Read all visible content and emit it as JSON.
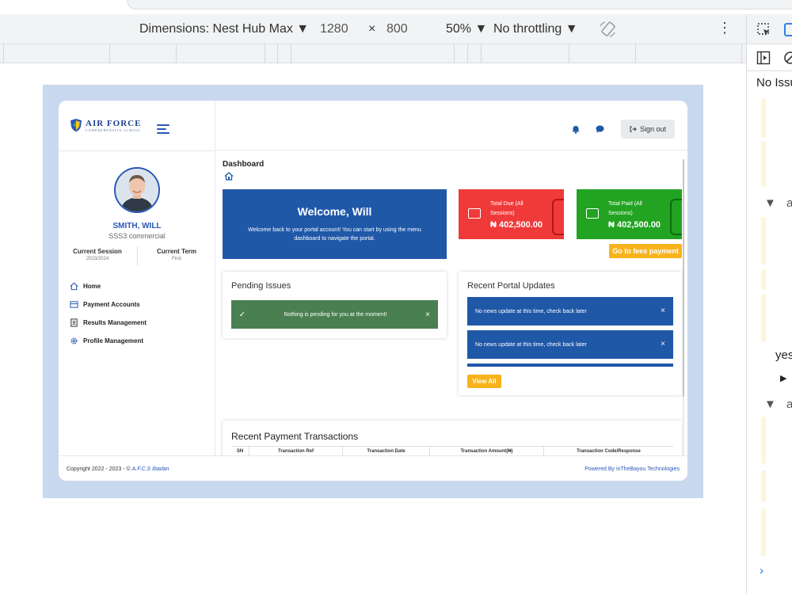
{
  "devtools": {
    "dimensions_label": "Dimensions: Nest Hub Max",
    "width": "1280",
    "times": "×",
    "height": "800",
    "zoom": "50%",
    "throttling": "No throttling",
    "issues_label": "No Issu",
    "panel_text_yes": "yes",
    "panel_text_a1": "a",
    "panel_text_a2": "a"
  },
  "app": {
    "logo_title": "AIR FORCE",
    "logo_subtitle": "COMPREHENSIVE SCHOOL",
    "signout_label": "Sign out",
    "user": {
      "name": "SMITH, WILL",
      "class": "SSS3 commercial"
    },
    "session": {
      "label": "Current Session",
      "value": "2023/2024"
    },
    "term": {
      "label": "Current Term",
      "value": "First"
    },
    "menu": [
      {
        "label": "Home",
        "icon": "home-icon"
      },
      {
        "label": "Payment Accounts",
        "icon": "credit-card-icon"
      },
      {
        "label": "Results Management",
        "icon": "document-icon"
      },
      {
        "label": "Profile Management",
        "icon": "gear-icon"
      }
    ],
    "page_title": "Dashboard",
    "welcome": {
      "heading": "Welcome, Will",
      "text": "Welcome back to your portal account! You can start by using the menu dashboard to navigate the portal."
    },
    "total_due": {
      "label": "Total Due (All Sessions)",
      "value": "₦ 402,500.00"
    },
    "total_paid": {
      "label": "Total Paid (All Sessions)",
      "value": "₦ 402,500.00"
    },
    "fees_button": "Go to fees payment",
    "pending": {
      "title": "Pending Issues",
      "message": "Nothing is pending for you at the moment!",
      "check": "✓",
      "close": "×"
    },
    "updates": {
      "title": "Recent Portal Updates",
      "items": [
        "No news update at this time, check back later",
        "No news update at this time, check back later"
      ],
      "close": "×",
      "view_all": "View All"
    },
    "transactions": {
      "title": "Recent Payment Transactions",
      "columns": [
        "SN",
        "Transaction Ref",
        "Transaction Date",
        "Transaction Amount(₦)",
        "Transaction Code/Response"
      ]
    },
    "footer": {
      "copyright": "Copyright 2022 - 2023 - © ",
      "school": "A.F.C.S Ibadan",
      "powered": "Powered By inTheBayou Technologies"
    },
    "colors": {
      "primary": "#2058a8",
      "danger": "#f03a3a",
      "success": "#22a322",
      "warning": "#f8b31c",
      "alert_green": "#4a8051"
    }
  }
}
